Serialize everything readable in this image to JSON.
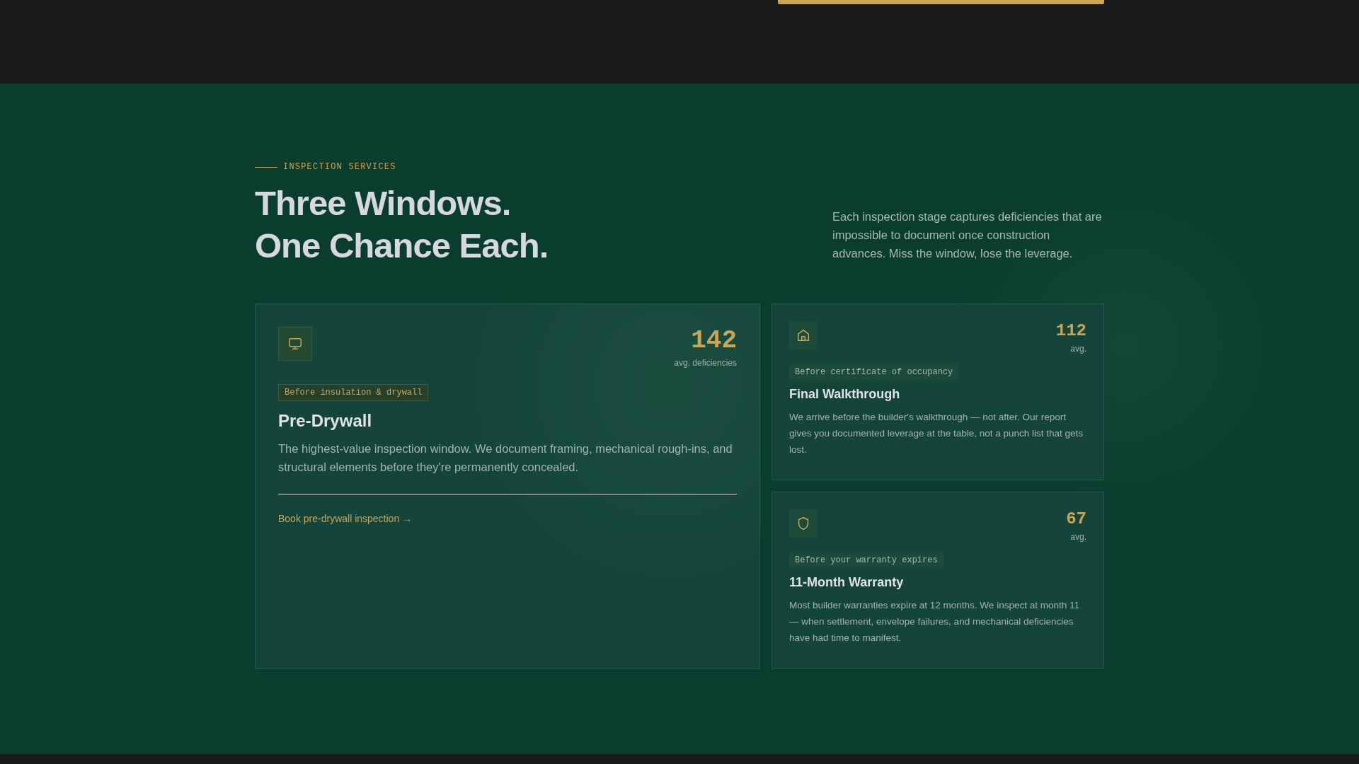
{
  "section": {
    "eyebrow": "INSPECTION SERVICES",
    "heading_lines": [
      "Three Windows.",
      "One Chance Each."
    ],
    "intro": "Each inspection stage captures deficiencies that are impossible to document once construction advances. Miss the window, lose the leverage."
  },
  "services": [
    {
      "kind": "featured",
      "count": "142",
      "count_label": "avg. deficiencies",
      "tag": "Before insulation & drywall",
      "title": "Pre-Drywall",
      "description": "The highest-value inspection window. We document framing, mechanical rough-ins, and structural elements before they're permanently concealed.",
      "link": "Book pre-drywall inspection →"
    },
    {
      "kind": "compact",
      "count": "112",
      "count_label": "avg.",
      "tag": "Before certificate of occupancy",
      "title": "Final Walkthrough",
      "description": "We arrive before the builder's walkthrough — not after. Our report gives you documented leverage at the table, not a punch list that gets lost."
    },
    {
      "kind": "compact",
      "count": "67",
      "count_label": "avg.",
      "tag": "Before your warranty expires",
      "title": "11-Month Warranty",
      "description": "Most builder warranties expire at 12 months. We inspect at month 11 — when settlement, envelope failures, and mechanical deficiencies have had time to manifest."
    }
  ]
}
